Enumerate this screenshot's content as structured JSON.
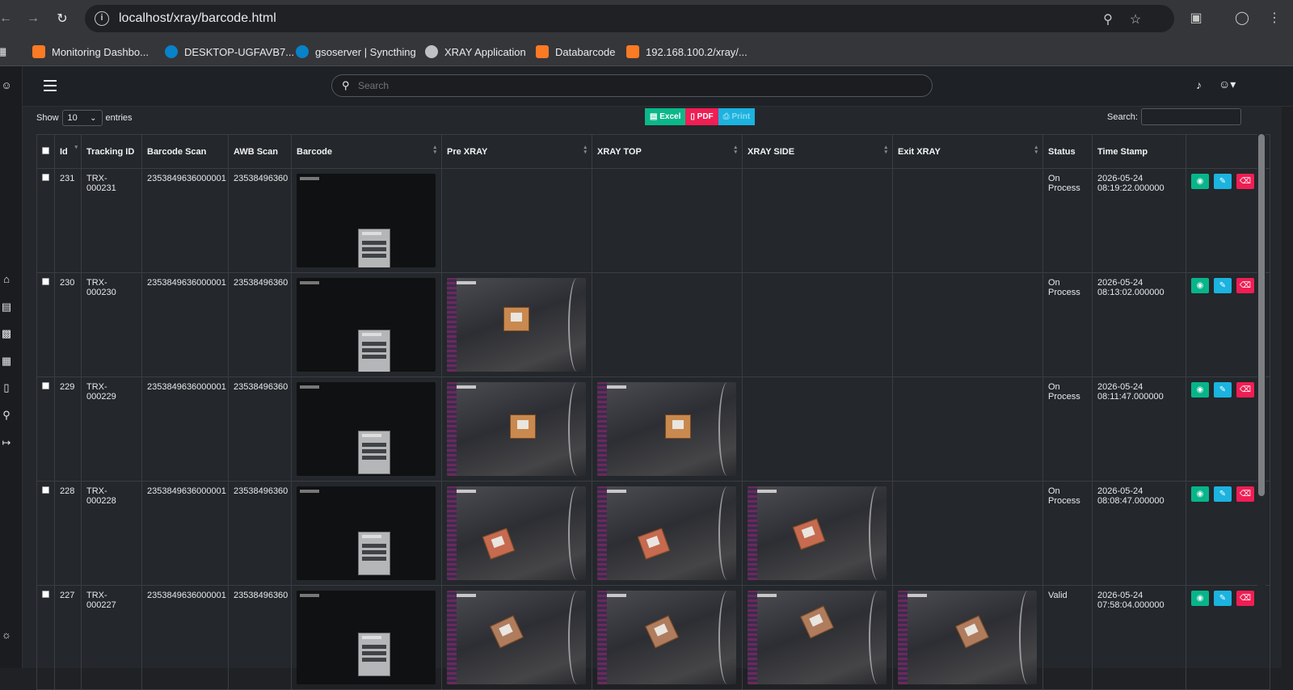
{
  "browser": {
    "url": "localhost/xray/barcode.html",
    "bookmarks": [
      {
        "label": "Monitoring Dashbo...",
        "icon": "xampp-icon"
      },
      {
        "label": "DESKTOP-UGFAVB7...",
        "icon": "syncthing-icon"
      },
      {
        "label": "gsoserver | Syncthing",
        "icon": "syncthing-icon"
      },
      {
        "label": "XRAY Application",
        "icon": "globe-icon"
      },
      {
        "label": "Databarcode",
        "icon": "xampp-icon"
      },
      {
        "label": "192.168.100.2/xray/...",
        "icon": "xampp-icon"
      }
    ]
  },
  "topbar": {
    "search_placeholder": "Search"
  },
  "controls": {
    "show_label": "Show",
    "entries_value": "10",
    "entries_label": "entries",
    "excel_label": "Excel",
    "pdf_label": "PDF",
    "print_label": "Print",
    "search_label": "Search:"
  },
  "colors": {
    "excel": "#0bb88a",
    "pdf": "#ef1e54",
    "print": "#1bb3e0"
  },
  "table": {
    "headers": [
      "Id",
      "Tracking ID",
      "Barcode Scan",
      "AWB Scan",
      "Barcode",
      "Pre XRAY",
      "XRAY TOP",
      "XRAY SIDE",
      "Exit XRAY",
      "Status",
      "Time Stamp"
    ],
    "rows": [
      {
        "id": "231",
        "tracking": "TRX-000231",
        "barcode_scan": "2353849636000001",
        "awb_scan": "23538496360",
        "status": "On Process",
        "timestamp": "2026-05-24 08:19:22.000000",
        "images": [
          true,
          false,
          false,
          false,
          false
        ]
      },
      {
        "id": "230",
        "tracking": "TRX-000230",
        "barcode_scan": "2353849636000001",
        "awb_scan": "23538496360",
        "status": "On Process",
        "timestamp": "2026-05-24 08:13:02.000000",
        "images": [
          true,
          true,
          false,
          false,
          false
        ]
      },
      {
        "id": "229",
        "tracking": "TRX-000229",
        "barcode_scan": "2353849636000001",
        "awb_scan": "23538496360",
        "status": "On Process",
        "timestamp": "2026-05-24 08:11:47.000000",
        "images": [
          true,
          true,
          true,
          false,
          false
        ]
      },
      {
        "id": "228",
        "tracking": "TRX-000228",
        "barcode_scan": "2353849636000001",
        "awb_scan": "23538496360",
        "status": "On Process",
        "timestamp": "2026-05-24 08:08:47.000000",
        "images": [
          true,
          true,
          true,
          true,
          false
        ]
      },
      {
        "id": "227",
        "tracking": "TRX-000227",
        "barcode_scan": "2353849636000001",
        "awb_scan": "23538496360",
        "status": "Valid",
        "timestamp": "2026-05-24 07:58:04.000000",
        "images": [
          true,
          true,
          true,
          true,
          true
        ]
      }
    ]
  }
}
